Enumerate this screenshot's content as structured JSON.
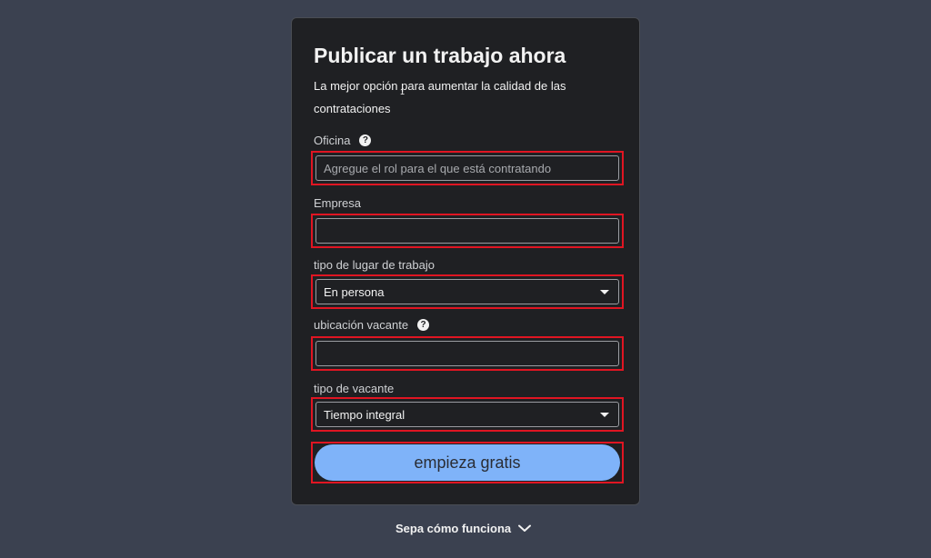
{
  "form": {
    "title": "Publicar un trabajo ahora",
    "subtitle": "La mejor opción para aumentar la calidad de las contrataciones",
    "stray_mark": "1",
    "help_icon_glyph": "?",
    "fields": {
      "office": {
        "label": "Oficina",
        "placeholder": "Agregue el rol para el que está contratando",
        "value": ""
      },
      "company": {
        "label": "Empresa",
        "value": ""
      },
      "workplace_type": {
        "label": "tipo de lugar de trabajo",
        "selected": "En persona"
      },
      "location": {
        "label": "ubicación vacante",
        "value": ""
      },
      "job_type": {
        "label": "tipo de vacante",
        "selected": "Tiempo integral"
      }
    },
    "submit_label": "empieza gratis"
  },
  "footer": {
    "how_it_works": "Sepa cómo funciona",
    "icon": "chevron-down-icon"
  },
  "colors": {
    "background": "#3b4150",
    "card": "#1f2023",
    "highlight_outline": "#e01522",
    "primary_button": "#7fb3f9",
    "text": "#f2f2f2"
  }
}
